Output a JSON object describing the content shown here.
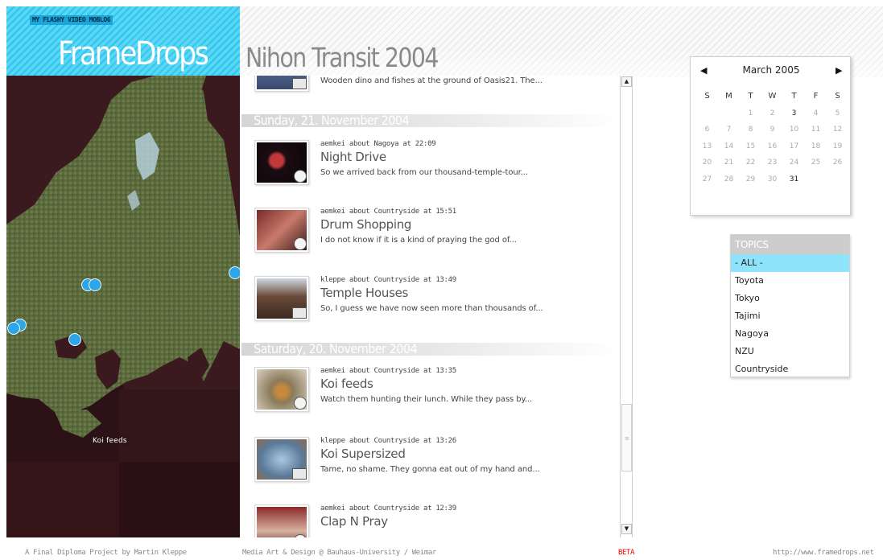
{
  "header": {
    "tagline": "MY FLASHY VIDEO MOBLOG",
    "app_title": "FrameDrops",
    "page_title": "Nihon Transit 2004",
    "blue_color": "#2cc6ee"
  },
  "map": {
    "tooltip": "Koi feeds",
    "marker_color": "#2ba6e8"
  },
  "feed": {
    "top_entry_desc": "Wooden dino and fishes at the ground of Oasis21. The...",
    "days": [
      {
        "label": "Sunday, 21. November 2004"
      },
      {
        "label": "Saturday, 20. November 2004"
      }
    ],
    "entries": [
      {
        "meta": "aemkei about Nagoya at 22:09",
        "title": "Night Drive",
        "desc": "So we arrived back from our thousand-temple-tour...",
        "type": "video-icon"
      },
      {
        "meta": "aemkei about Countryside at 15:51",
        "title": "Drum Shopping",
        "desc": "I do not know if it is a kind of praying the god of...",
        "type": "video-icon"
      },
      {
        "meta": "kleppe about Countryside at 13:49",
        "title": "Temple Houses",
        "desc": "So, I guess we have now seen more than thousands of...",
        "type": "photo-icon"
      },
      {
        "meta": "aemkei about Countryside at 13:35",
        "title": "Koi feeds",
        "desc": "Watch them hunting their lunch. While they pass by...",
        "type": "video-icon"
      },
      {
        "meta": "kleppe about Countryside at 13:26",
        "title": "Koi Supersized",
        "desc": "Tame, no shame. They gonna eat out of my hand and...",
        "type": "photo-icon"
      },
      {
        "meta": "aemkei about Countryside at 12:39",
        "title": "Clap N Pray",
        "desc": "",
        "type": "video-icon"
      }
    ]
  },
  "calendar": {
    "month": "March 2005",
    "prev": "◀",
    "next": "▶",
    "weekdays": [
      "S",
      "M",
      "T",
      "W",
      "T",
      "F",
      "S"
    ],
    "weeks": [
      [
        "",
        "",
        "1",
        "2",
        "3",
        "4",
        "5"
      ],
      [
        "6",
        "7",
        "8",
        "9",
        "10",
        "11",
        "12"
      ],
      [
        "13",
        "14",
        "15",
        "16",
        "17",
        "18",
        "19"
      ],
      [
        "20",
        "21",
        "22",
        "23",
        "24",
        "25",
        "26"
      ],
      [
        "27",
        "28",
        "29",
        "30",
        "31",
        "",
        ""
      ]
    ],
    "active_days": [
      "3",
      "31"
    ]
  },
  "topics": {
    "header": "TOPICS",
    "items": [
      "- ALL -",
      "Toyota",
      "Tokyo",
      "Tajimi",
      "Nagoya",
      "NZU",
      "Countryside"
    ],
    "selected": "- ALL -"
  },
  "footer": {
    "credit": "A Final Diploma Project by Martin Kleppe",
    "school": "Media Art & Design @ Bauhaus-University / Weimar",
    "beta": "BETA",
    "url": "http://www.framedrops.net",
    "beta_color": "#e60000"
  }
}
